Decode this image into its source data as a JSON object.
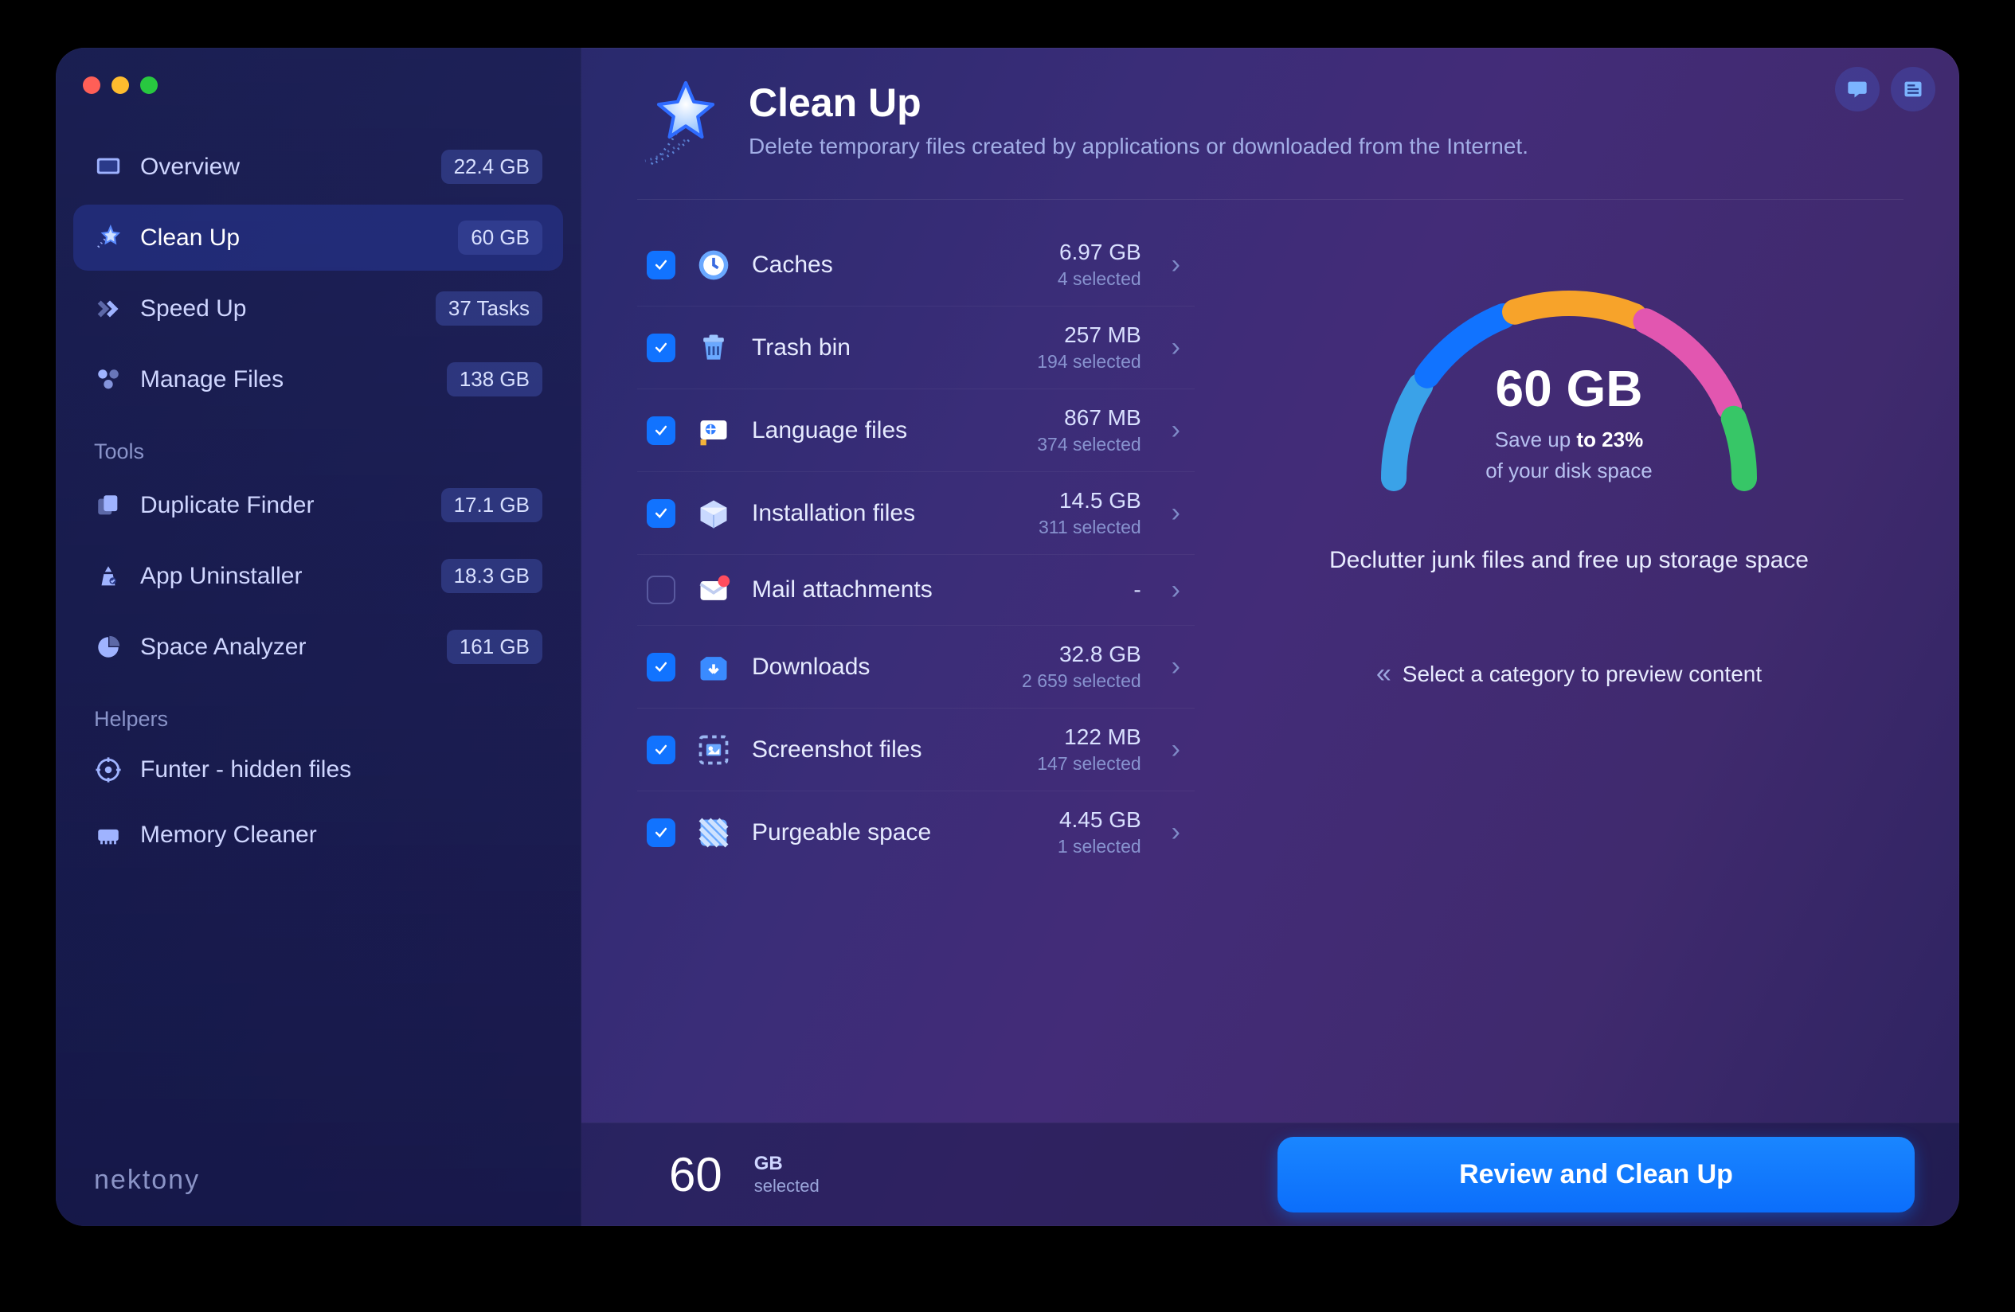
{
  "brand": "nektony",
  "header": {
    "title": "Clean Up",
    "subtitle": "Delete temporary files created by applications or downloaded from the Internet."
  },
  "sidebar": {
    "main": [
      {
        "icon": "overview-icon",
        "label": "Overview",
        "badge": "22.4 GB",
        "active": false
      },
      {
        "icon": "cleanup-icon",
        "label": "Clean Up",
        "badge": "60 GB",
        "active": true
      },
      {
        "icon": "speedup-icon",
        "label": "Speed Up",
        "badge": "37 Tasks",
        "active": false
      },
      {
        "icon": "manage-icon",
        "label": "Manage Files",
        "badge": "138 GB",
        "active": false
      }
    ],
    "tools_title": "Tools",
    "tools": [
      {
        "icon": "duplicate-icon",
        "label": "Duplicate Finder",
        "badge": "17.1 GB"
      },
      {
        "icon": "uninstaller-icon",
        "label": "App Uninstaller",
        "badge": "18.3 GB"
      },
      {
        "icon": "analyzer-icon",
        "label": "Space Analyzer",
        "badge": "161 GB"
      }
    ],
    "helpers_title": "Helpers",
    "helpers": [
      {
        "icon": "funter-icon",
        "label": "Funter - hidden files",
        "badge": ""
      },
      {
        "icon": "memory-icon",
        "label": "Memory Cleaner",
        "badge": ""
      }
    ]
  },
  "categories": [
    {
      "icon": "caches-icon",
      "label": "Caches",
      "size": "6.97 GB",
      "selected": "4 selected",
      "checked": true
    },
    {
      "icon": "trash-icon",
      "label": "Trash bin",
      "size": "257 MB",
      "selected": "194 selected",
      "checked": true
    },
    {
      "icon": "language-icon",
      "label": "Language files",
      "size": "867 MB",
      "selected": "374 selected",
      "checked": true
    },
    {
      "icon": "install-icon",
      "label": "Installation files",
      "size": "14.5 GB",
      "selected": "311 selected",
      "checked": true
    },
    {
      "icon": "mail-icon",
      "label": "Mail attachments",
      "size": "-",
      "selected": "",
      "checked": false
    },
    {
      "icon": "downloads-icon",
      "label": "Downloads",
      "size": "32.8 GB",
      "selected": "2 659 selected",
      "checked": true
    },
    {
      "icon": "screenshot-icon",
      "label": "Screenshot files",
      "size": "122 MB",
      "selected": "147 selected",
      "checked": true
    },
    {
      "icon": "purgeable-icon",
      "label": "Purgeable space",
      "size": "4.45 GB",
      "selected": "1 selected",
      "checked": true
    }
  ],
  "gauge": {
    "value": "60 GB",
    "save_prefix": "Save up ",
    "save_bold": "to 23%",
    "save_line2": "of your disk space",
    "segments": [
      {
        "color": "#3aa2e8",
        "start": 180,
        "end": 212
      },
      {
        "color": "#1173ff",
        "start": 216,
        "end": 248
      },
      {
        "color": "#f7a32a",
        "start": 252,
        "end": 292
      },
      {
        "color": "#e256b0",
        "start": 296,
        "end": 336
      },
      {
        "color": "#37c667",
        "start": 340,
        "end": 360
      }
    ]
  },
  "declutter_text": "Declutter junk files and free up storage space",
  "hint_text": "Select a category to preview content",
  "footer": {
    "number": "60",
    "unit": "GB",
    "sub": "selected",
    "button": "Review and Clean Up"
  }
}
